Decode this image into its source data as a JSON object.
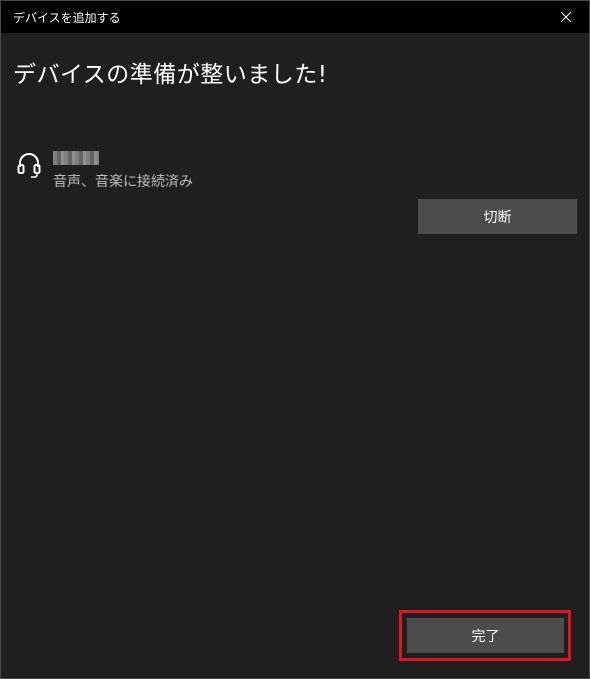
{
  "window": {
    "title": "デバイスを追加する",
    "close_icon": "close-icon"
  },
  "main": {
    "heading": "デバイスの準備が整いました!",
    "device": {
      "icon": "headset-icon",
      "name": "",
      "status": "音声、音楽に接続済み",
      "disconnect_label": "切断"
    },
    "done_label": "完了"
  },
  "colors": {
    "background": "#1f1f1f",
    "titlebar": "#000000",
    "button": "#4c4c4c",
    "highlight": "#e0141e"
  }
}
